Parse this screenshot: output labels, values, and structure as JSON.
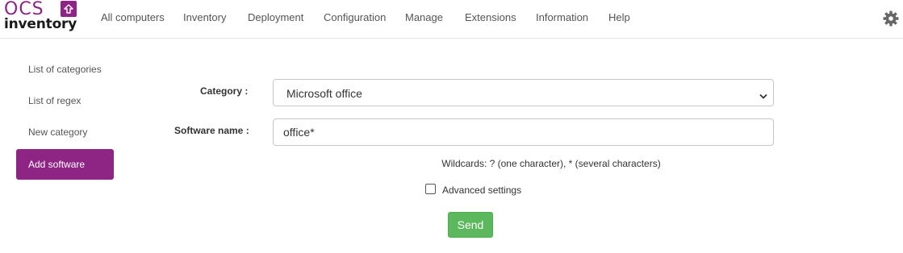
{
  "logo": {
    "brand": "OCS",
    "product": "inventory"
  },
  "nav": [
    {
      "label": "All computers"
    },
    {
      "label": "Inventory"
    },
    {
      "label": "Deployment"
    },
    {
      "label": "Configuration"
    },
    {
      "label": "Manage"
    },
    {
      "label": "Extensions"
    },
    {
      "label": "Information"
    },
    {
      "label": "Help"
    }
  ],
  "sidebar": {
    "items": [
      {
        "label": "List of categories",
        "active": false
      },
      {
        "label": "List of regex",
        "active": false
      },
      {
        "label": "New category",
        "active": false
      },
      {
        "label": "Add software",
        "active": true
      }
    ]
  },
  "form": {
    "category_label": "Category :",
    "category_value": "Microsoft office",
    "software_label": "Software name :",
    "software_value": "office*",
    "wildcards_hint": "Wildcards: ? (one character), * (several characters)",
    "advanced_label": "Advanced settings",
    "advanced_checked": false,
    "send_label": "Send"
  },
  "colors": {
    "brand_purple": "#8e2585",
    "send_green": "#5cb85c"
  },
  "icons": {
    "settings": "gear-icon",
    "select": "chevron-down-icon",
    "logo_badge": "upload-arrow-icon"
  }
}
